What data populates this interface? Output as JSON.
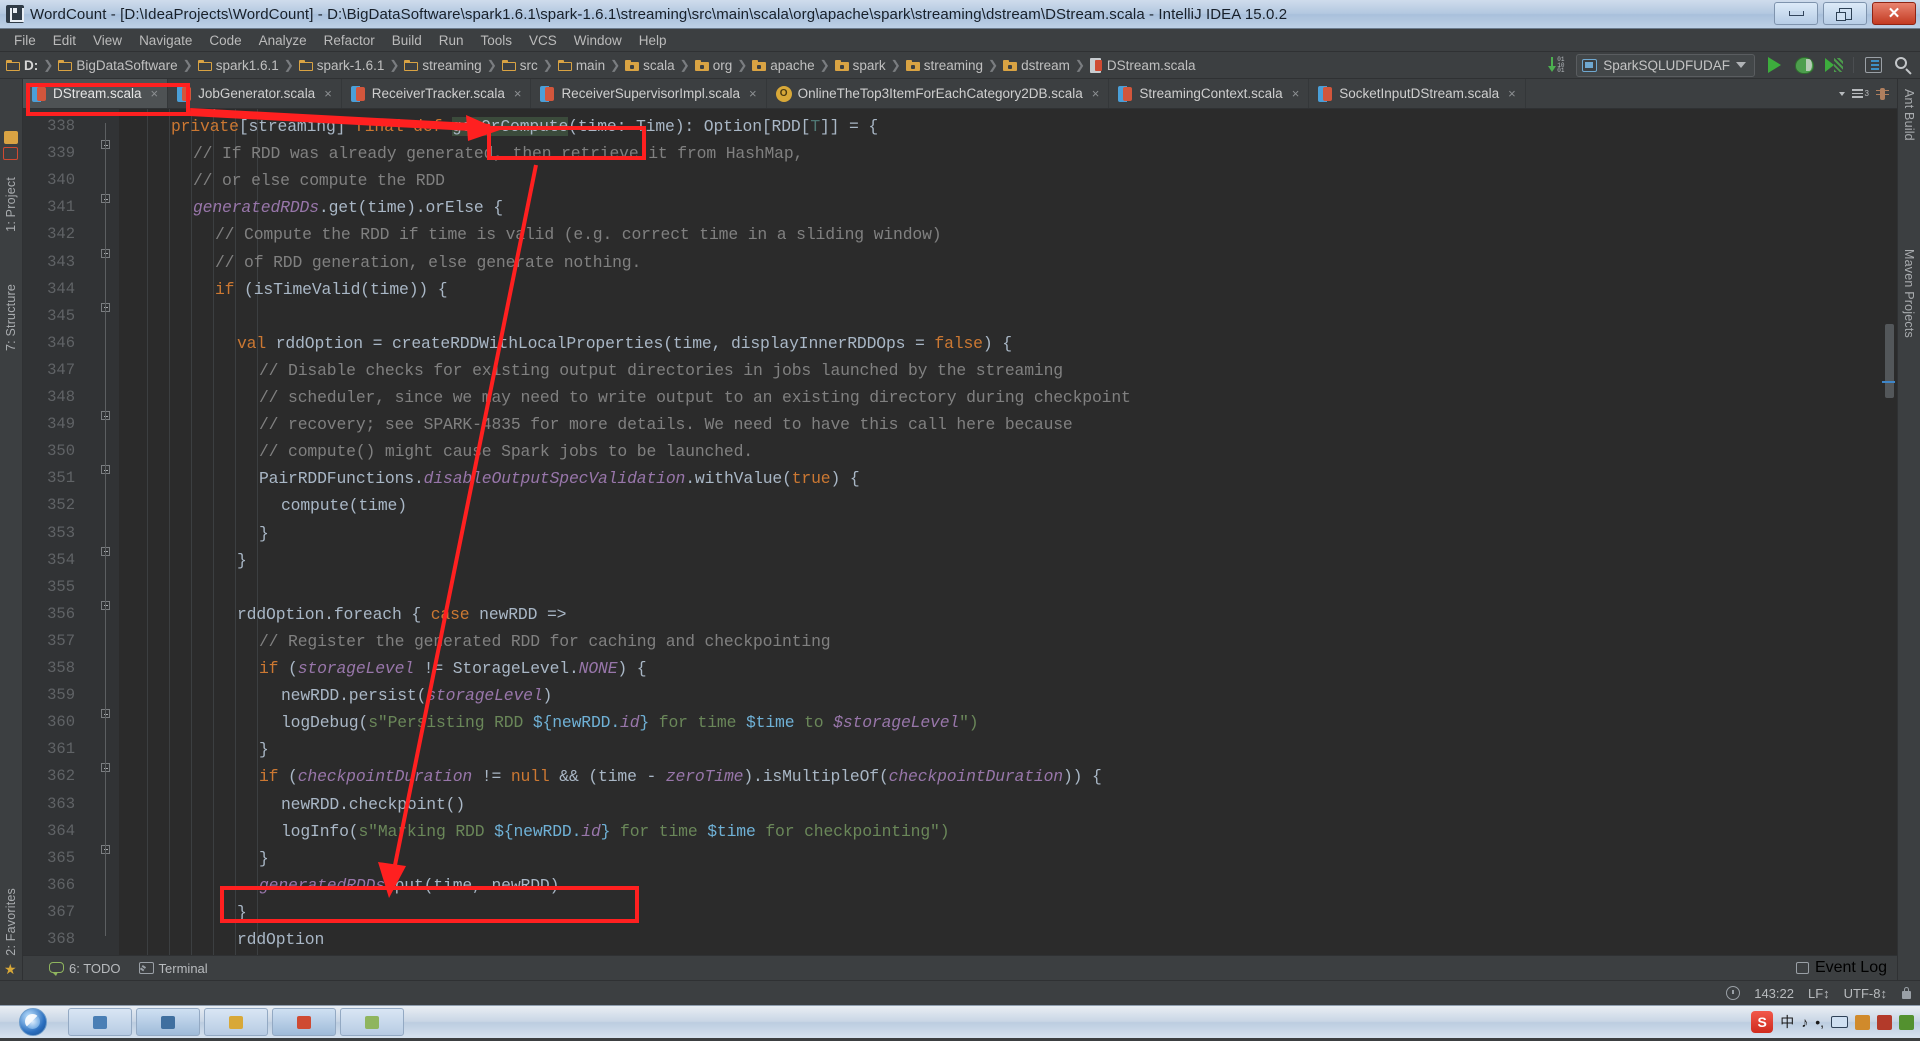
{
  "window": {
    "title": "WordCount - [D:\\IdeaProjects\\WordCount] - D:\\BigDataSoftware\\spark1.6.1\\spark-1.6.1\\streaming\\src\\main\\scala\\org\\apache\\spark\\streaming\\dstream\\DStream.scala - IntelliJ IDEA 15.0.2",
    "minimize_label": "Minimize",
    "restore_label": "Restore",
    "close_label": "Close"
  },
  "menubar": {
    "items": [
      {
        "label": "File"
      },
      {
        "label": "Edit"
      },
      {
        "label": "View"
      },
      {
        "label": "Navigate"
      },
      {
        "label": "Code"
      },
      {
        "label": "Analyze"
      },
      {
        "label": "Refactor"
      },
      {
        "label": "Build"
      },
      {
        "label": "Run"
      },
      {
        "label": "Tools"
      },
      {
        "label": "VCS"
      },
      {
        "label": "Window"
      },
      {
        "label": "Help"
      }
    ]
  },
  "breadcrumb": {
    "items": [
      {
        "label": "D:",
        "icon": "folder-icon"
      },
      {
        "label": "BigDataSoftware",
        "icon": "folder-icon"
      },
      {
        "label": "spark1.6.1",
        "icon": "folder-icon"
      },
      {
        "label": "spark-1.6.1",
        "icon": "folder-icon"
      },
      {
        "label": "streaming",
        "icon": "folder-icon"
      },
      {
        "label": "src",
        "icon": "folder-icon"
      },
      {
        "label": "main",
        "icon": "folder-icon"
      },
      {
        "label": "scala",
        "icon": "source-folder-icon"
      },
      {
        "label": "org",
        "icon": "source-folder-icon"
      },
      {
        "label": "apache",
        "icon": "source-folder-icon"
      },
      {
        "label": "spark",
        "icon": "source-folder-icon"
      },
      {
        "label": "streaming",
        "icon": "source-folder-icon"
      },
      {
        "label": "dstream",
        "icon": "source-folder-icon"
      },
      {
        "label": "DStream.scala",
        "icon": "scala-file-icon"
      }
    ]
  },
  "toolbar": {
    "run_configuration": "SparkSQLUDFUDAF",
    "sort_icon": "binary-sort-icon",
    "run_icon": "run-icon",
    "debug_icon": "debug-icon",
    "coverage_icon": "run-with-coverage-icon",
    "database_icon": "database-icon",
    "search_icon": "search-everywhere-icon"
  },
  "tabs": {
    "items": [
      {
        "label": "DStream.scala",
        "icon": "scala-file-icon",
        "active": true,
        "close": "×"
      },
      {
        "label": "JobGenerator.scala",
        "icon": "scala-file-icon",
        "active": false,
        "close": "×"
      },
      {
        "label": "ReceiverTracker.scala",
        "icon": "scala-file-icon",
        "active": false,
        "close": "×"
      },
      {
        "label": "ReceiverSupervisorImpl.scala",
        "icon": "scala-file-icon",
        "active": false,
        "close": "×"
      },
      {
        "label": "OnlineTheTop3ItemForEachCategory2DB.scala",
        "icon": "scala-object-icon",
        "active": false,
        "close": "×"
      },
      {
        "label": "StreamingContext.scala",
        "icon": "scala-file-icon",
        "active": false,
        "close": "×"
      },
      {
        "label": "SocketInputDStream.scala",
        "icon": "scala-file-icon",
        "active": false,
        "close": "×"
      }
    ],
    "list_icon": "tab-list-icon",
    "list_badge": "3",
    "ant_icon": "ant-build-icon"
  },
  "left_strip": {
    "items": [
      {
        "label": "1: Project"
      },
      {
        "label": "7: Structure"
      },
      {
        "label": "2: Favorites"
      }
    ]
  },
  "right_strip": {
    "items": [
      {
        "label": "Ant Build"
      },
      {
        "label": "Maven Projects"
      }
    ]
  },
  "editor": {
    "first_line": 338,
    "lines": [
      {
        "n": 338,
        "indent": 2,
        "tokens": [
          {
            "t": "private",
            "c": "kw"
          },
          {
            "t": "[streaming] ",
            "c": "pln"
          },
          {
            "t": "final def ",
            "c": "kw"
          },
          {
            "t": "getOrCompute",
            "c": "hl"
          },
          {
            "t": "(time: Time): Option[RDD[",
            "c": "pln"
          },
          {
            "t": "T",
            "c": "tparam"
          },
          {
            "t": "]] = {",
            "c": "pln"
          }
        ]
      },
      {
        "n": 339,
        "indent": 3,
        "tokens": [
          {
            "t": "// If RDD was already generated, then retrieve it from HashMap,",
            "c": "cm"
          }
        ]
      },
      {
        "n": 340,
        "indent": 3,
        "tokens": [
          {
            "t": "// or else compute the RDD",
            "c": "cm"
          }
        ]
      },
      {
        "n": 341,
        "indent": 3,
        "tokens": [
          {
            "t": "generatedRDDs",
            "c": "fld"
          },
          {
            "t": ".get(time).orElse {",
            "c": "pln"
          }
        ]
      },
      {
        "n": 342,
        "indent": 4,
        "tokens": [
          {
            "t": "// Compute the RDD if time is valid (e.g. correct time in a sliding window)",
            "c": "cm"
          }
        ]
      },
      {
        "n": 343,
        "indent": 4,
        "tokens": [
          {
            "t": "// of RDD generation, else generate nothing.",
            "c": "cm"
          }
        ]
      },
      {
        "n": 344,
        "indent": 4,
        "tokens": [
          {
            "t": "if",
            "c": "kw"
          },
          {
            "t": " (isTimeValid(time)) {",
            "c": "pln"
          }
        ]
      },
      {
        "n": 345,
        "indent": 0,
        "tokens": []
      },
      {
        "n": 346,
        "indent": 5,
        "tokens": [
          {
            "t": "val",
            "c": "kw"
          },
          {
            "t": " rddOption = createRDDWithLocalProperties(time, displayInnerRDDOps = ",
            "c": "pln"
          },
          {
            "t": "false",
            "c": "kw"
          },
          {
            "t": ") {",
            "c": "pln"
          }
        ]
      },
      {
        "n": 347,
        "indent": 6,
        "tokens": [
          {
            "t": "// Disable checks for existing output directories in jobs launched by the streaming",
            "c": "cm"
          }
        ]
      },
      {
        "n": 348,
        "indent": 6,
        "tokens": [
          {
            "t": "// scheduler, since we may need to write output to an existing directory during checkpoint",
            "c": "cm"
          }
        ]
      },
      {
        "n": 349,
        "indent": 6,
        "tokens": [
          {
            "t": "// recovery; see SPARK-4835 for more details. We need to have this call here because",
            "c": "cm"
          }
        ]
      },
      {
        "n": 350,
        "indent": 6,
        "tokens": [
          {
            "t": "// compute() might cause Spark jobs to be launched.",
            "c": "cm"
          }
        ]
      },
      {
        "n": 351,
        "indent": 6,
        "tokens": [
          {
            "t": "PairRDDFunctions.",
            "c": "pln"
          },
          {
            "t": "disableOutputSpecValidation",
            "c": "fld"
          },
          {
            "t": ".withValue(",
            "c": "pln"
          },
          {
            "t": "true",
            "c": "kw"
          },
          {
            "t": ") {",
            "c": "pln"
          }
        ]
      },
      {
        "n": 352,
        "indent": 7,
        "tokens": [
          {
            "t": "compute(time)",
            "c": "pln"
          }
        ]
      },
      {
        "n": 353,
        "indent": 6,
        "tokens": [
          {
            "t": "}",
            "c": "pln"
          }
        ]
      },
      {
        "n": 354,
        "indent": 5,
        "tokens": [
          {
            "t": "}",
            "c": "pln"
          }
        ]
      },
      {
        "n": 355,
        "indent": 0,
        "tokens": []
      },
      {
        "n": 356,
        "indent": 5,
        "tokens": [
          {
            "t": "rddOption.foreach { ",
            "c": "pln"
          },
          {
            "t": "case",
            "c": "kw"
          },
          {
            "t": " newRDD =>",
            "c": "pln"
          }
        ]
      },
      {
        "n": 357,
        "indent": 6,
        "tokens": [
          {
            "t": "// Register the generated RDD for caching and checkpointing",
            "c": "cm"
          }
        ]
      },
      {
        "n": 358,
        "indent": 6,
        "tokens": [
          {
            "t": "if",
            "c": "kw"
          },
          {
            "t": " (",
            "c": "pln"
          },
          {
            "t": "storageLevel",
            "c": "fld"
          },
          {
            "t": " != StorageLevel.",
            "c": "pln"
          },
          {
            "t": "NONE",
            "c": "fld"
          },
          {
            "t": ") {",
            "c": "pln"
          }
        ]
      },
      {
        "n": 359,
        "indent": 7,
        "tokens": [
          {
            "t": "newRDD.persist(",
            "c": "pln"
          },
          {
            "t": "storageLevel",
            "c": "fld"
          },
          {
            "t": ")",
            "c": "pln"
          }
        ]
      },
      {
        "n": 360,
        "indent": 7,
        "tokens": [
          {
            "t": "logDebug(",
            "c": "pln"
          },
          {
            "t": "s\"",
            "c": "str"
          },
          {
            "t": "Persisting RDD ",
            "c": "str"
          },
          {
            "t": "${newRDD.",
            "c": "sinj"
          },
          {
            "t": "id",
            "c": "fld"
          },
          {
            "t": "}",
            "c": "sinj"
          },
          {
            "t": " for time ",
            "c": "str"
          },
          {
            "t": "$time",
            "c": "sinj"
          },
          {
            "t": " to ",
            "c": "str"
          },
          {
            "t": "$storageLevel",
            "c": "fldsinj"
          },
          {
            "t": "\")",
            "c": "str"
          }
        ]
      },
      {
        "n": 361,
        "indent": 6,
        "tokens": [
          {
            "t": "}",
            "c": "pln"
          }
        ]
      },
      {
        "n": 362,
        "indent": 6,
        "tokens": [
          {
            "t": "if",
            "c": "kw"
          },
          {
            "t": " (",
            "c": "pln"
          },
          {
            "t": "checkpointDuration",
            "c": "fld"
          },
          {
            "t": " != ",
            "c": "pln"
          },
          {
            "t": "null",
            "c": "kw"
          },
          {
            "t": " && (time - ",
            "c": "pln"
          },
          {
            "t": "zeroTime",
            "c": "fld"
          },
          {
            "t": ").isMultipleOf(",
            "c": "pln"
          },
          {
            "t": "checkpointDuration",
            "c": "fld"
          },
          {
            "t": ")) {",
            "c": "pln"
          }
        ]
      },
      {
        "n": 363,
        "indent": 7,
        "tokens": [
          {
            "t": "newRDD.checkpoint()",
            "c": "pln"
          }
        ]
      },
      {
        "n": 364,
        "indent": 7,
        "tokens": [
          {
            "t": "logInfo(",
            "c": "pln"
          },
          {
            "t": "s\"",
            "c": "str"
          },
          {
            "t": "Marking RDD ",
            "c": "str"
          },
          {
            "t": "${newRDD.",
            "c": "sinj"
          },
          {
            "t": "id",
            "c": "fld"
          },
          {
            "t": "}",
            "c": "sinj"
          },
          {
            "t": " for time ",
            "c": "str"
          },
          {
            "t": "$time",
            "c": "sinj"
          },
          {
            "t": " for checkpointing",
            "c": "str"
          },
          {
            "t": "\")",
            "c": "str"
          }
        ]
      },
      {
        "n": 365,
        "indent": 6,
        "tokens": [
          {
            "t": "}",
            "c": "pln"
          }
        ]
      },
      {
        "n": 366,
        "indent": 6,
        "tokens": [
          {
            "t": "generatedRDDs",
            "c": "fld"
          },
          {
            "t": ".put(time, newRDD)",
            "c": "pln"
          }
        ]
      },
      {
        "n": 367,
        "indent": 5,
        "tokens": [
          {
            "t": "}",
            "c": "pln"
          }
        ]
      },
      {
        "n": 368,
        "indent": 5,
        "tokens": [
          {
            "t": "rddOption",
            "c": "pln"
          }
        ]
      }
    ]
  },
  "annotations": {
    "highlight_boxes": [
      {
        "name": "getorcompute-box",
        "color": "#ff2020"
      },
      {
        "name": "generatedrdds-put-box",
        "color": "#ff2020"
      },
      {
        "name": "dstream-tab-box",
        "color": "#ff2020"
      }
    ],
    "arrows": [
      {
        "name": "tab-to-getorcompute-arrow",
        "color": "#ff2020"
      },
      {
        "name": "getorcompute-to-put-arrow",
        "color": "#ff2020"
      }
    ]
  },
  "bottom_tools": {
    "todo_label": "6: TODO",
    "terminal_label": "Terminal",
    "event_log_label": "Event Log"
  },
  "statusbar": {
    "position": "143:22",
    "line_separator": "LF↕",
    "encoding": "UTF-8↕",
    "lock_icon": "read-only-lock-icon"
  },
  "taskbar": {
    "start_label": "Start",
    "tray": {
      "ime_logo": "S",
      "ime_mode": "中",
      "ime_punct": "，",
      "time": ""
    }
  },
  "colors": {
    "editor_bg": "#2b2b2b",
    "gutter_bg": "#313335",
    "chrome_bg": "#3c3f41",
    "keyword": "#cc7832",
    "comment": "#808080",
    "field": "#9876aa",
    "string": "#6a8759",
    "number": "#6897bb",
    "plain": "#a9b7c6",
    "annotation_red": "#ff2020",
    "accent_blue": "#4a9fd8"
  }
}
